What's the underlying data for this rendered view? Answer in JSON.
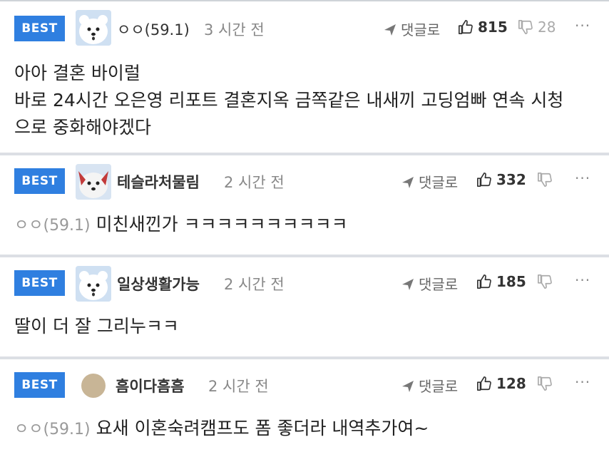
{
  "comments": [
    {
      "badge": "BEST",
      "nickname": "ㅇㅇ(59.1)",
      "time": "3 시간 전",
      "reply_label": "댓글로",
      "likes": "815",
      "dislikes": "28",
      "more": "···",
      "lines": [
        "아아 결혼 바이럴",
        "바로 24시간 오은영 리포트 결혼지옥 금쪽같은 내새끼 고딩엄빠 연속 시청",
        "으로 중화해야겠다"
      ]
    },
    {
      "badge": "BEST",
      "nickname": "테슬라처물림",
      "time": "2 시간 전",
      "reply_label": "댓글로",
      "likes": "332",
      "dislikes": "",
      "more": "···",
      "parent": "ㅇㅇ(59.1)",
      "text": "미친새낀가 ㅋㅋㅋㅋㅋㅋㅋㅋㅋㅋ"
    },
    {
      "badge": "BEST",
      "nickname": "일상생활가능",
      "time": "2 시간 전",
      "reply_label": "댓글로",
      "likes": "185",
      "dislikes": "",
      "more": "···",
      "text": "딸이 더 잘 그리누ㅋㅋ"
    },
    {
      "badge": "BEST",
      "nickname": "흠이다흠흠",
      "time": "2 시간 전",
      "reply_label": "댓글로",
      "likes": "128",
      "dislikes": "",
      "more": "···",
      "parent": "ㅇㅇ(59.1)",
      "text": "요새 이혼숙려캠프도 폼 좋더라 내역추가여~"
    }
  ],
  "colors": {
    "badge": "#2f7fe0",
    "divider": "#dcdfe4"
  }
}
